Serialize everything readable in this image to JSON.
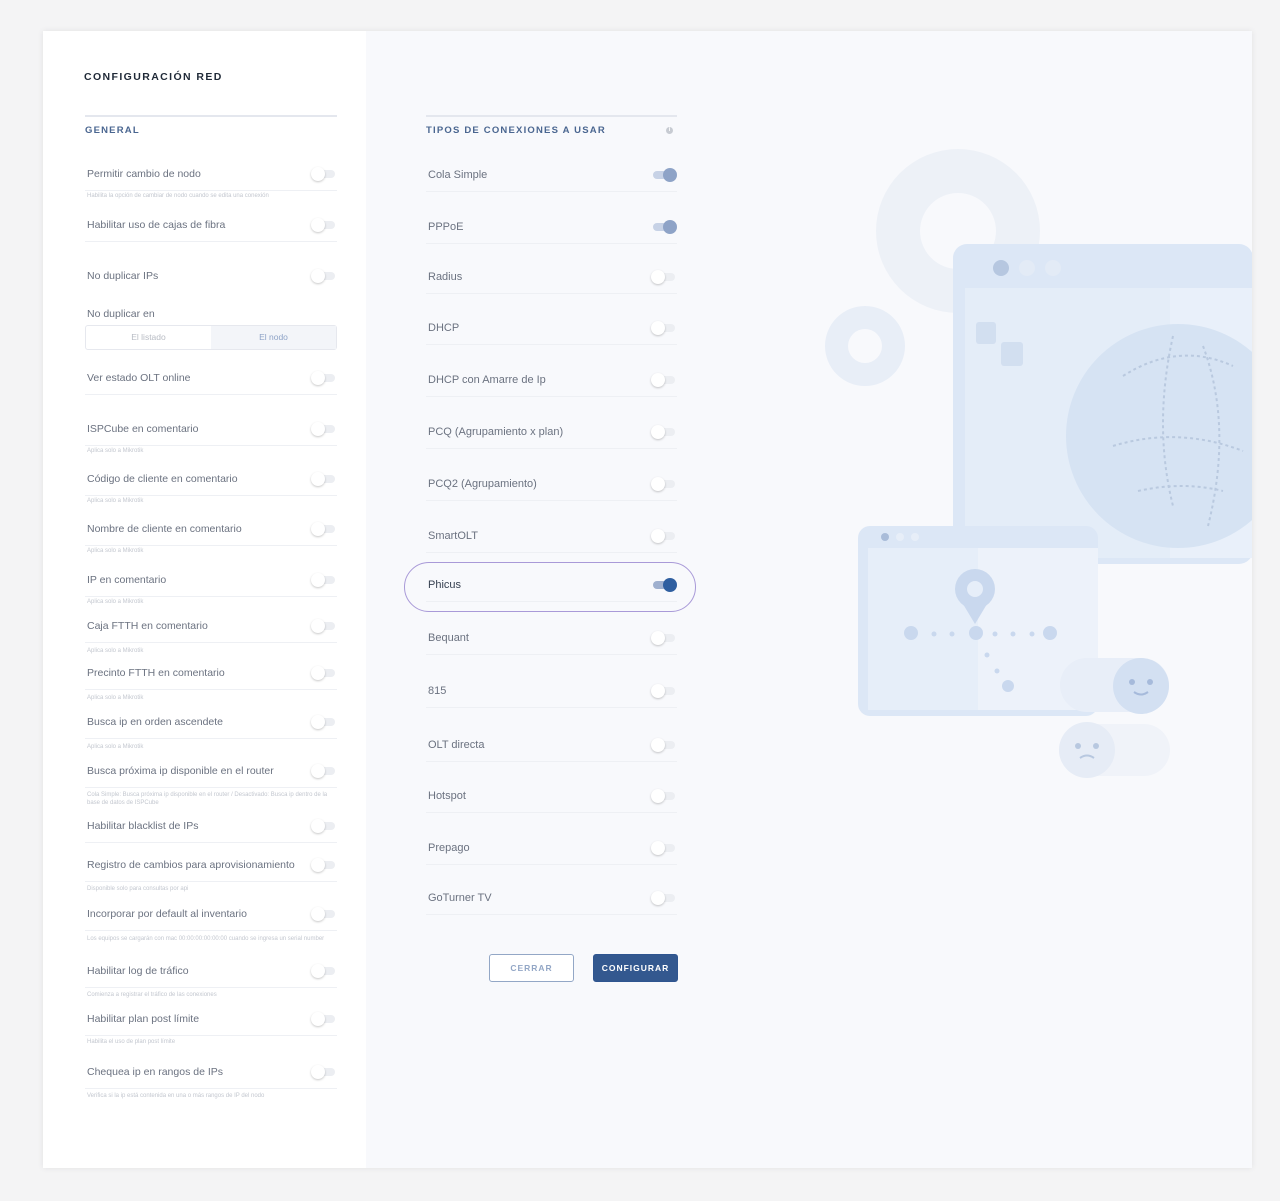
{
  "title": "CONFIGURACIÓN RED",
  "general": {
    "heading": "GENERAL",
    "items": [
      {
        "label": "Permitir cambio de nodo",
        "on": false,
        "hint": "Habilita la opción de cambiar de nodo cuando se edita una conexión"
      },
      {
        "label": "Habilitar uso de cajas de fibra",
        "on": false
      },
      {
        "label": "No duplicar IPs",
        "on": false
      },
      {
        "label": "Ver estado OLT online",
        "on": false
      },
      {
        "label": "ISPCube en comentario",
        "on": false,
        "hint": "Aplica solo a Mikrotik"
      },
      {
        "label": "Código de cliente en comentario",
        "on": false,
        "hint": "Aplica solo a Mikrotik"
      },
      {
        "label": "Nombre de cliente en comentario",
        "on": false,
        "hint": "Aplica solo a Mikrotik"
      },
      {
        "label": "IP  en comentario",
        "on": false,
        "hint": "Aplica solo a Mikrotik"
      },
      {
        "label": "Caja FTTH en comentario",
        "on": false,
        "hint": "Aplica solo a Mikrotik"
      },
      {
        "label": "Precinto FTTH en comentario",
        "on": false,
        "hint": "Aplica solo a Mikrotik"
      },
      {
        "label": "Busca ip en orden ascendete",
        "on": false,
        "hint": "Aplica solo a Mikrotik"
      },
      {
        "label": "Busca próxima ip disponible en el router",
        "on": false,
        "hint": "Cola Simple: Busca próxima ip disponible en el router / Desactivado: Busca ip dentro de la base de datos de ISPCube"
      },
      {
        "label": "Habilitar blacklist de IPs",
        "on": false
      },
      {
        "label": "Registro de cambios para aprovisionamiento",
        "on": false,
        "hint": "Disponible solo para consultas por api"
      },
      {
        "label": "Incorporar por default al inventario",
        "on": false,
        "hint": "Los equipos se cargarán con mac 00:00:00:00:00:00 cuando se ingresa un serial number"
      },
      {
        "label": "Habilitar log de tráfico",
        "on": false,
        "hint": "Comienza a registrar el tráfico de las conexiones"
      },
      {
        "label": "Habilitar plan post límite",
        "on": false,
        "hint": "Habilita el uso de plan post límite"
      },
      {
        "label": "Chequea ip en rangos de IPs",
        "on": false,
        "hint": "Verifica si la ip está contenida en una o más rangos de IP del nodo"
      }
    ],
    "no_duplicar": {
      "label": "No duplicar en",
      "options": [
        "El listado",
        "El nodo"
      ],
      "selected": "El nodo"
    }
  },
  "connections": {
    "heading": "TIPOS DE CONEXIONES A USAR",
    "items": [
      {
        "label": "Cola Simple",
        "on": true
      },
      {
        "label": "PPPoE",
        "on": true
      },
      {
        "label": "Radius",
        "on": false
      },
      {
        "label": "DHCP",
        "on": false
      },
      {
        "label": "DHCP con Amarre de Ip",
        "on": false
      },
      {
        "label": "PCQ (Agrupamiento x plan)",
        "on": false
      },
      {
        "label": "PCQ2  (Agrupamiento)",
        "on": false
      },
      {
        "label": "SmartOLT",
        "on": false
      },
      {
        "label": "Phicus",
        "on": true
      },
      {
        "label": "Bequant",
        "on": false
      },
      {
        "label": "815",
        "on": false
      },
      {
        "label": "OLT directa",
        "on": false
      },
      {
        "label": "Hotspot",
        "on": false
      },
      {
        "label": "Prepago",
        "on": false
      },
      {
        "label": "GoTurner TV",
        "on": false
      }
    ]
  },
  "buttons": {
    "close": "CERRAR",
    "configure": "CONFIGURAR"
  },
  "colors": {
    "accent": "#33588f",
    "highlight": "#a99ad8",
    "illustration": "#dbe6f5"
  }
}
